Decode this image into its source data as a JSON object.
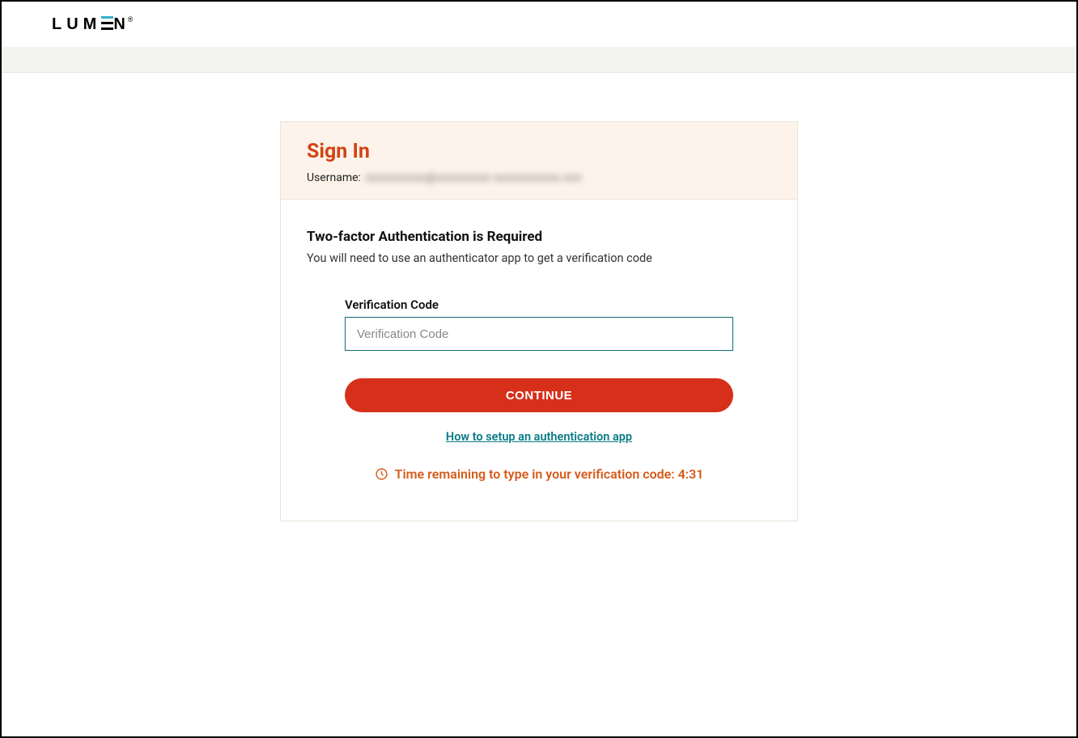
{
  "brand": {
    "name": "LUMEN"
  },
  "card": {
    "title": "Sign In",
    "username_label": "Username:",
    "username_value": "xxxxxxxxxx@xxxxxxxxx.xxxxxxxxxxx.xxx",
    "tfa_heading": "Two-factor Authentication is Required",
    "tfa_sub": "You will need to use an authenticator app to get a verification code",
    "code_label": "Verification Code",
    "code_placeholder": "Verification Code",
    "continue_label": "CONTINUE",
    "help_link": "How to setup an authentication app",
    "timer_prefix": "Time remaining to type in your verification code: ",
    "timer_value": "4:31"
  }
}
